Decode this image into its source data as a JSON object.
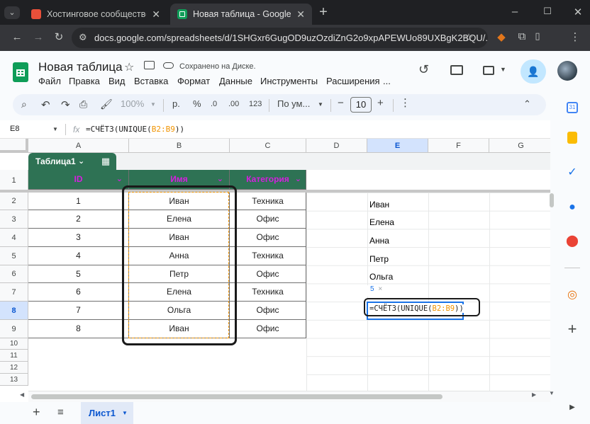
{
  "browser": {
    "tabs": [
      {
        "title": "Хостинговое сообщество «Tim",
        "active": false,
        "favicon_color": "#e8503a"
      },
      {
        "title": "Новая таблица - Google Табли",
        "active": true,
        "favicon_color": "#0f9d58"
      }
    ],
    "address": "docs.google.com/spreadsheets/d/1SHGxr6GugOD9uzOzdiZnG2o9xpAPEWUo89UXBgK2BQU/...",
    "icons": [
      "tab-search-icon",
      "new-tab-icon",
      "minimize-icon",
      "maximize-icon",
      "close-icon",
      "back-icon",
      "forward-icon",
      "reload-icon",
      "site-info-icon",
      "bookmark-star-icon",
      "extension-fox-icon",
      "extensions-icon",
      "sidebar-icon",
      "profile-avatar",
      "menu-dots-icon"
    ]
  },
  "doc": {
    "title": "Новая таблица",
    "saved_status": "Сохранено на Диске.",
    "menu": [
      "Файл",
      "Правка",
      "Вид",
      "Вставка",
      "Формат",
      "Данные",
      "Инструменты",
      "Расширения",
      "..."
    ]
  },
  "toolbar": {
    "zoom": "100%",
    "currency": "р.",
    "percent": "%",
    "dec_less": ".0",
    "dec_more": ".00",
    "number_format": "123",
    "font": "По ум...",
    "font_size": "10",
    "minus": "−",
    "plus": "+"
  },
  "formula_bar": {
    "cell_ref": "E8",
    "fx": "fx",
    "formula_prefix": "=СЧЁТЗ(UNIQUE(",
    "formula_range": "B2:B9",
    "formula_suffix": "))"
  },
  "columns": [
    "A",
    "B",
    "C",
    "D",
    "E",
    "F",
    "G"
  ],
  "rows": [
    "1",
    "2",
    "3",
    "4",
    "5",
    "6",
    "7",
    "8",
    "9",
    "10",
    "11",
    "12",
    "13"
  ],
  "table": {
    "name": "Таблица1",
    "headers": [
      "ID",
      "Имя",
      "Категория"
    ],
    "rows": [
      [
        "1",
        "Иван",
        "Техника"
      ],
      [
        "2",
        "Елена",
        "Офис"
      ],
      [
        "3",
        "Иван",
        "Офис"
      ],
      [
        "4",
        "Анна",
        "Техника"
      ],
      [
        "5",
        "Петр",
        "Офис"
      ],
      [
        "6",
        "Елена",
        "Техника"
      ],
      [
        "7",
        "Ольга",
        "Офис"
      ],
      [
        "8",
        "Иван",
        "Офис"
      ]
    ]
  },
  "unique_list": [
    "Иван",
    "Елена",
    "Анна",
    "Петр",
    "Ольга"
  ],
  "result_tooltip": {
    "value": "5",
    "close": "×"
  },
  "editing_cell": {
    "prefix": "=СЧЁТЗ(UNIQUE(",
    "range": "B2:B9",
    "suffix": "))"
  },
  "sheet": {
    "name": "Лист1"
  },
  "colors": {
    "header_bg": "#2e7254",
    "header_text": "#d61ee0",
    "range_color": "#f09300",
    "accent": "#1a73e8",
    "tab_active": "#0b57d0"
  }
}
